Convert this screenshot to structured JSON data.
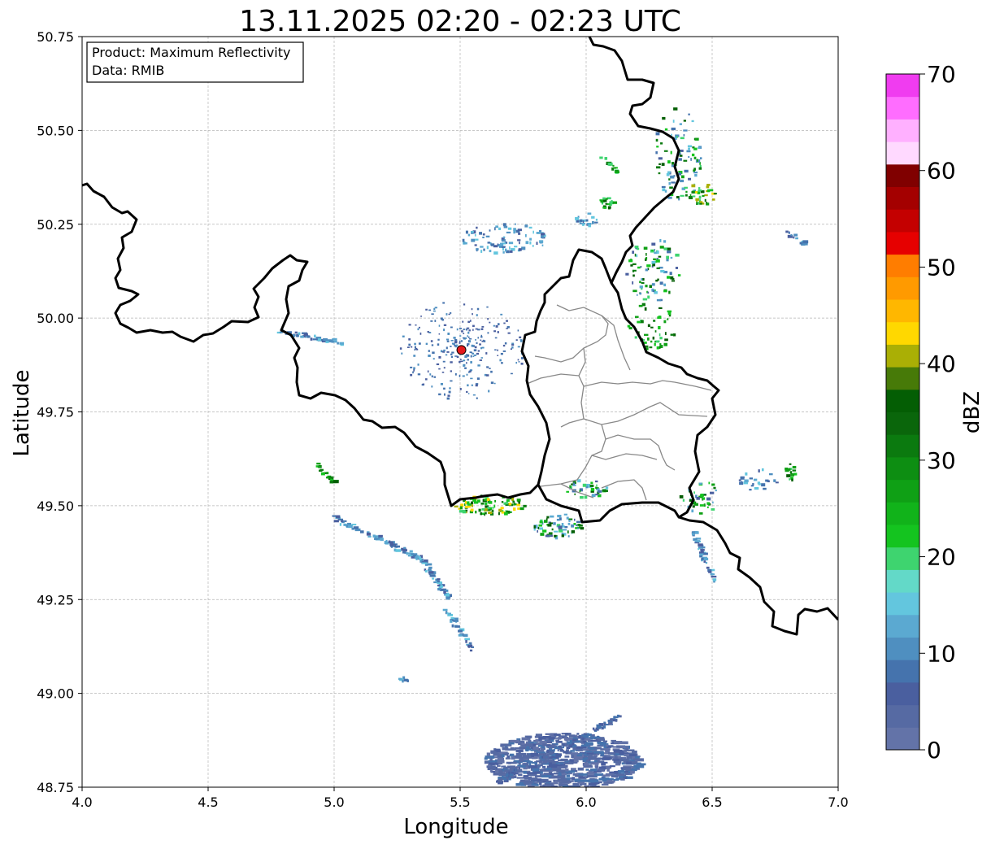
{
  "title": "13.11.2025 02:20 - 02:23 UTC",
  "info_box": {
    "product": "Product: Maximum Reflectivity",
    "data": "Data: RMIB"
  },
  "axes": {
    "xlabel": "Longitude",
    "ylabel": "Latitude",
    "xlim": [
      4.0,
      7.0
    ],
    "ylim": [
      48.75,
      50.75
    ],
    "xticks": [
      "4.0",
      "4.5",
      "5.0",
      "5.5",
      "6.0",
      "6.5",
      "7.0"
    ],
    "yticks": [
      "48.75",
      "49.00",
      "49.25",
      "49.50",
      "49.75",
      "50.00",
      "50.25",
      "50.50",
      "50.75"
    ],
    "grid": true
  },
  "radar_site": {
    "lon": 5.505,
    "lat": 49.915,
    "color": "#e41a1c"
  },
  "colorbar": {
    "label": "dBZ",
    "ticks": [
      "0",
      "10",
      "20",
      "30",
      "40",
      "50",
      "60",
      "70"
    ],
    "range": [
      0,
      70
    ],
    "colors": [
      "#6373a8",
      "#566aa3",
      "#4a5f9f",
      "#4573ad",
      "#4f8fc0",
      "#5ba9d1",
      "#63c6de",
      "#63d9c8",
      "#3ed46f",
      "#14c41f",
      "#11b31a",
      "#0fa015",
      "#0d8e12",
      "#0b7a0f",
      "#0a660b",
      "#045e04",
      "#477a08",
      "#aaaf05",
      "#ffd800",
      "#ffb700",
      "#ff9a00",
      "#ff7d00",
      "#e60000",
      "#c40000",
      "#a40000",
      "#800000",
      "#ffd9ff",
      "#ffb0ff",
      "#ff6dff",
      "#f03cf0"
    ]
  },
  "icons": {
    "radar_site": "radar-site-marker-icon"
  }
}
